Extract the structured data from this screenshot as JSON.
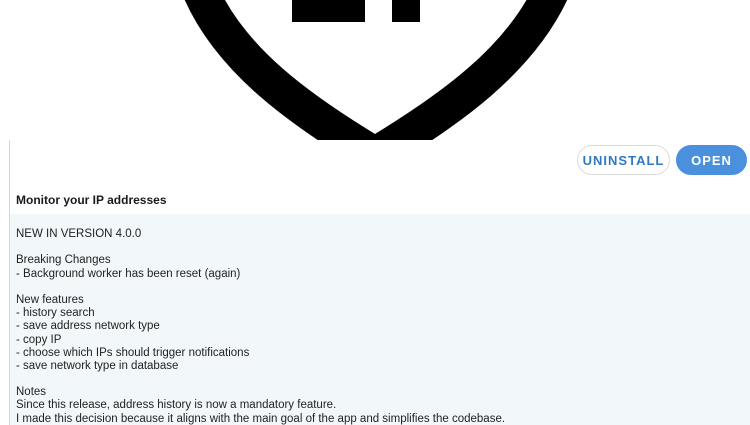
{
  "actions": {
    "uninstall_label": "UNINSTALL",
    "open_label": "OPEN"
  },
  "app": {
    "summary": "Monitor your IP addresses"
  },
  "release_notes": {
    "version_heading": "NEW IN VERSION 4.0.0",
    "breaking_title": "Breaking Changes",
    "breaking_items": [
      "- Background worker has been reset (again)"
    ],
    "features_title": "New features",
    "features_items": [
      "- history search",
      "- save address network type",
      "- copy IP",
      "- choose which IPs should trigger notifications",
      "- save network type in database"
    ],
    "notes_title": "Notes",
    "notes_lines": [
      "Since this release, address history is now a mandatory feature.",
      "I made this decision because it aligns with the main goal of the app and simplifies the codebase."
    ]
  },
  "colors": {
    "primary": "#4a90dd",
    "primary_text": "#2f79c8",
    "notes_background": "#f2f7fa"
  },
  "icons": {
    "logo": "app-logo-icon"
  }
}
